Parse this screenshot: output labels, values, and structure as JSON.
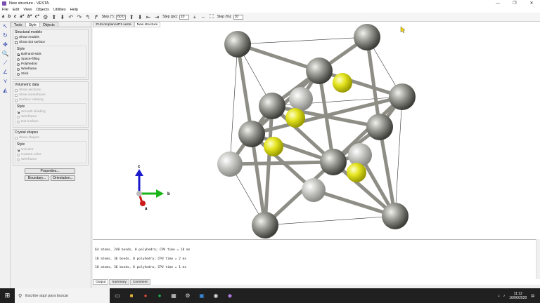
{
  "window": {
    "title": "New structure - VESTA"
  },
  "menu": [
    "File",
    "Edit",
    "View",
    "Objects",
    "Utilities",
    "Help"
  ],
  "toolbar": {
    "axis_buttons": [
      "a",
      "b",
      "c",
      "a*",
      "b*",
      "c*"
    ],
    "step_deg_label": "Step (°):",
    "step_deg_value": "60.0",
    "step_px_label": "Step (px):",
    "step_px_value": "10",
    "step_pct_label": "Step (%):",
    "step_pct_value": "10"
  },
  "panel": {
    "tabs": [
      "Tools",
      "Style",
      "Objects"
    ],
    "structural": {
      "title": "Structural models",
      "show_models": "Show models",
      "show_dot": "Show dot surface",
      "style_title": "Style",
      "styles": [
        "Ball-and-stick",
        "Space-filling",
        "Polyhedral",
        "Wireframe",
        "Stick"
      ]
    },
    "volumetric": {
      "title": "Volumetric data",
      "options": [
        "Show sections",
        "Show isosurfaces",
        "Surface coloring"
      ],
      "style_title": "Style",
      "styles": [
        "Smooth shading",
        "Wireframe",
        "Dot surface"
      ]
    },
    "crystal": {
      "title": "Crystal shapes",
      "show": "Show shapes",
      "style_title": "Style",
      "styles": [
        "Unicolor",
        "Custom color",
        "Wireframe"
      ]
    },
    "buttons": {
      "properties": "Properties...",
      "boundary": "Boundary...",
      "orientation": "Orientation..."
    }
  },
  "doc_tabs": [
    "ZnScomplanosP1.vesta",
    "New structure"
  ],
  "axes": {
    "a": "a",
    "b": "b",
    "c": "c"
  },
  "console": {
    "lines": [
      "64 atoms, 240 bonds, 0 polyhedra; CPU time = 10 ms",
      "18 atoms, 36 bonds, 0 polyhedra; CPU time = 2 ms",
      "18 atoms, 36 bonds, 0 polyhedra; CPU time = 1 ms"
    ],
    "tabs": [
      "Output",
      "Summary",
      "Comment"
    ]
  },
  "taskbar": {
    "search_placeholder": "Escribe aquí para buscar",
    "time": "11:12",
    "date": "16/06/2020"
  },
  "colors": {
    "zn_atom": "#8c8c86",
    "s_atom": "#e6e61c",
    "bond": "#8e8e86",
    "accent": "#3a4fb0"
  }
}
